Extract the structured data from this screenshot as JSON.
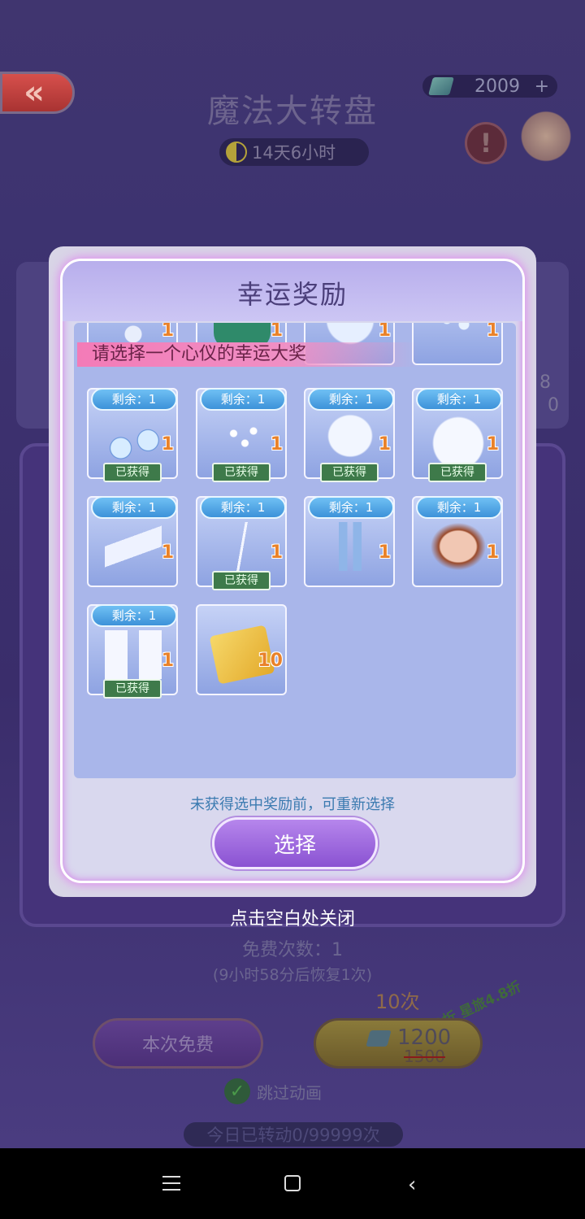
{
  "header": {
    "back_icon": "double-chevron-left-icon",
    "title": "魔法大转盘",
    "timer": "14天6小时",
    "gems": "2009",
    "gems_plus": "+",
    "info_icon": "exclamation-icon"
  },
  "background": {
    "side_numbers": [
      "8",
      "0"
    ],
    "free_count": "免费次数：1",
    "recover_note": "(9小时58分后恢复1次)",
    "ten_times_label": "10次",
    "discount_tag": "9折 星旅4.8折",
    "free_button": "本次免费",
    "price_new": "1200",
    "price_old": "1500",
    "skip_animation": "跳过动画",
    "today_count": "今日已转动0/99999次"
  },
  "modal": {
    "title": "幸运奖励",
    "banner": "请选择一个心仪的幸运大奖",
    "hint": "未获得选中奖励前，可重新选择",
    "select_button": "选择",
    "remaining_label": "剩余：1",
    "obtained_label": "已获得",
    "items": [
      {
        "name": "earring",
        "count": "1"
      },
      {
        "name": "green-boots",
        "count": "1"
      },
      {
        "name": "blue-hair",
        "count": "1"
      },
      {
        "name": "snowflake-accessory",
        "count": "1"
      },
      {
        "name": "snow-globe-earrings",
        "count": "1",
        "remaining": true,
        "obtained": true
      },
      {
        "name": "pearl-earrings",
        "count": "1",
        "remaining": true,
        "obtained": true
      },
      {
        "name": "lace-top",
        "count": "1",
        "remaining": true,
        "obtained": true
      },
      {
        "name": "white-dress",
        "count": "1",
        "remaining": true,
        "obtained": true
      },
      {
        "name": "silver-heels",
        "count": "1",
        "remaining": true,
        "obtained": false
      },
      {
        "name": "thin-necklace",
        "count": "1",
        "remaining": true,
        "obtained": true
      },
      {
        "name": "blue-stockings",
        "count": "1",
        "remaining": true,
        "obtained": false
      },
      {
        "name": "face-makeup",
        "count": "1",
        "remaining": true,
        "obtained": false
      },
      {
        "name": "white-gloves",
        "count": "1",
        "remaining": true,
        "obtained": true
      },
      {
        "name": "diamond-ticket",
        "count": "10",
        "remaining": false,
        "obtained": false
      }
    ]
  },
  "close_hint": "点击空白处关闭",
  "navbar": {
    "menu_icon": "menu-icon",
    "home_icon": "home-icon",
    "back_icon": "back-icon"
  }
}
